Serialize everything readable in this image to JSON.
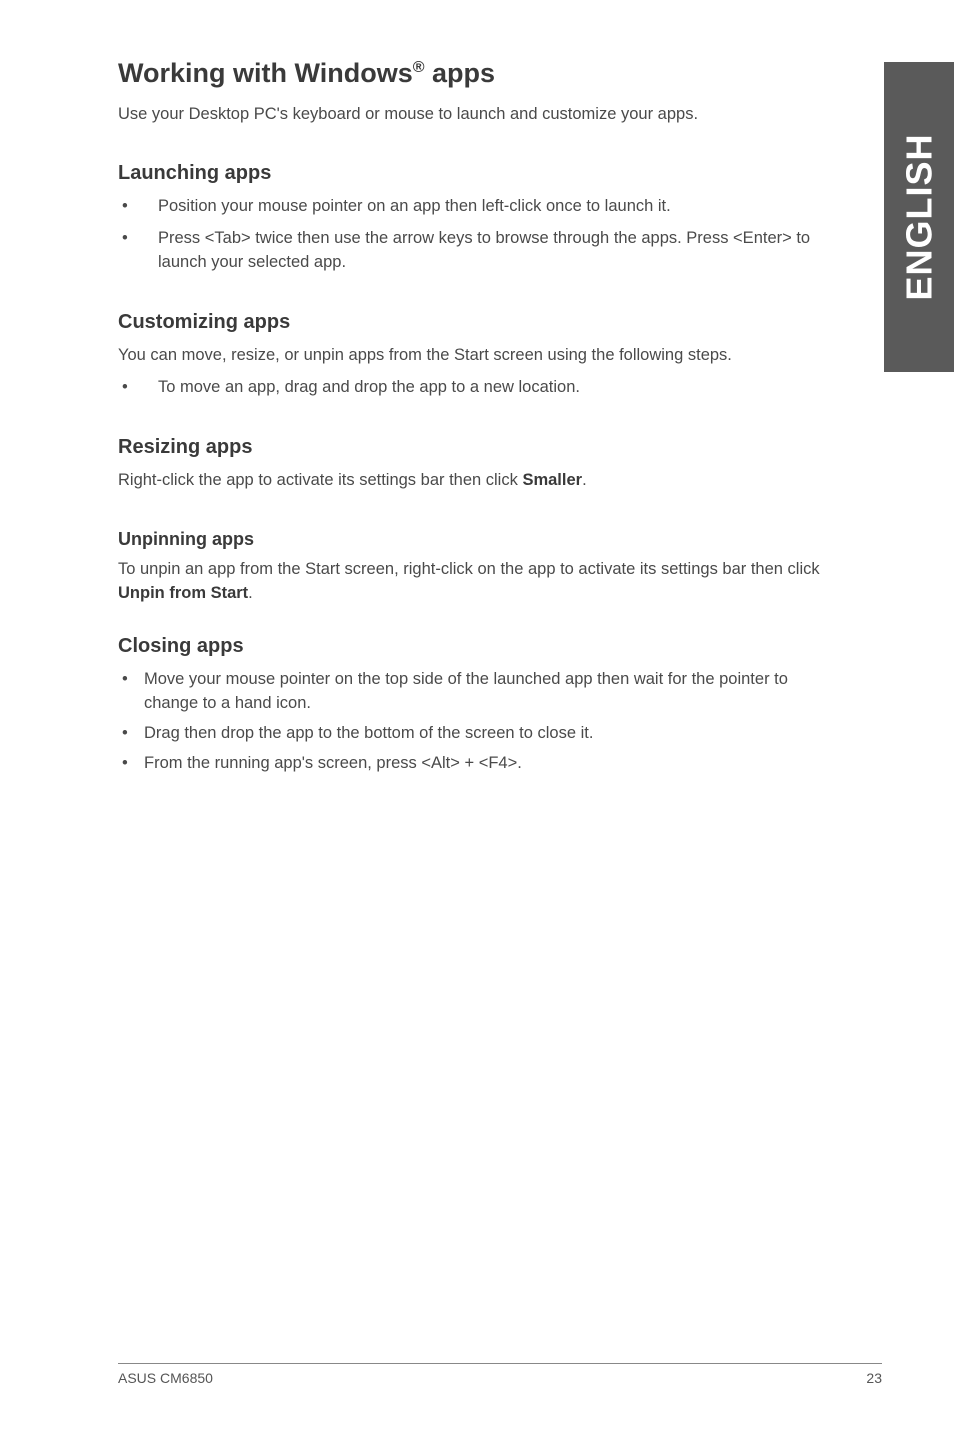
{
  "sideTab": "ENGLISH",
  "title_pre": "Working with Windows",
  "title_sup": "®",
  "title_post": " apps",
  "intro": "Use your Desktop PC's keyboard or mouse to launch and customize your apps.",
  "launching": {
    "heading": "Launching apps",
    "items": [
      "Position your mouse pointer on an app then left-click once to launch it.",
      "Press <Tab> twice then use the arrow keys to browse through the apps. Press <Enter> to launch your selected app."
    ]
  },
  "customizing": {
    "heading": "Customizing apps",
    "para": "You can move, resize, or unpin apps from the Start screen using the following steps.",
    "items": [
      "To move an app, drag and drop the app to a new location."
    ]
  },
  "resizing": {
    "heading": "Resizing apps",
    "para_pre": "Right-click the app to activate its settings bar then click ",
    "bold": "Smaller",
    "para_post": "."
  },
  "unpinning": {
    "heading": "Unpinning apps",
    "para_pre": "To unpin an app from the Start screen, right-click on the app to activate its settings bar then click ",
    "bold": "Unpin from Start",
    "para_post": "."
  },
  "closing": {
    "heading": "Closing apps",
    "items": [
      "Move your mouse pointer on the top side of the launched app then wait for the pointer to change to a hand icon.",
      "Drag then drop the app to the bottom of the screen to close it.",
      "From the running app's screen, press <Alt> + <F4>."
    ]
  },
  "footer": {
    "left": "ASUS CM6850",
    "right": "23"
  }
}
